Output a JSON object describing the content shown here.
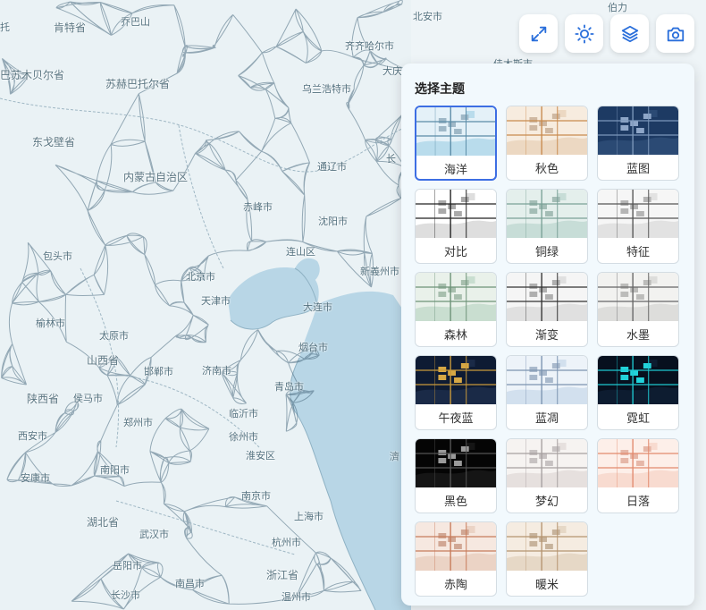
{
  "colors": {
    "map_bg": "#eef4f7",
    "road": "#4a6c80",
    "water": "#b8d6e6",
    "accent": "#3d6ee3"
  },
  "map": {
    "cities": [
      {
        "name": "托",
        "prov": false
      },
      {
        "name": "肯特省",
        "prov": true
      },
      {
        "name": "乔巴山",
        "prov": false
      },
      {
        "name": "北安市",
        "prov": false
      },
      {
        "name": "伯力",
        "prov": false
      },
      {
        "name": "齐齐哈尔市",
        "prov": false
      },
      {
        "name": "大庆",
        "prov": false
      },
      {
        "name": "佳木斯市",
        "prov": false
      },
      {
        "name": "巴苏木贝尔省",
        "prov": true
      },
      {
        "name": "苏赫巴托尔省",
        "prov": true
      },
      {
        "name": "乌兰浩特市",
        "prov": false
      },
      {
        "name": "东戈壁省",
        "prov": true
      },
      {
        "name": "通辽市",
        "prov": false
      },
      {
        "name": "长",
        "prov": false
      },
      {
        "name": "内蒙古自治区",
        "prov": true
      },
      {
        "name": "赤峰市",
        "prov": false
      },
      {
        "name": "沈阳市",
        "prov": false
      },
      {
        "name": "包头市",
        "prov": false
      },
      {
        "name": "连山区",
        "prov": false
      },
      {
        "name": "新義州市",
        "prov": false
      },
      {
        "name": "北京市",
        "prov": false
      },
      {
        "name": "天津市",
        "prov": false
      },
      {
        "name": "大连市",
        "prov": false
      },
      {
        "name": "榆林市",
        "prov": false
      },
      {
        "name": "太原市",
        "prov": false
      },
      {
        "name": "烟台市",
        "prov": false
      },
      {
        "name": "山西省",
        "prov": true
      },
      {
        "name": "邯郸市",
        "prov": false
      },
      {
        "name": "济南市",
        "prov": false
      },
      {
        "name": "青岛市",
        "prov": false
      },
      {
        "name": "陕西省",
        "prov": true
      },
      {
        "name": "侯马市",
        "prov": false
      },
      {
        "name": "郑州市",
        "prov": false
      },
      {
        "name": "临沂市",
        "prov": false
      },
      {
        "name": "西安市",
        "prov": false
      },
      {
        "name": "徐州市",
        "prov": false
      },
      {
        "name": "安康市",
        "prov": false
      },
      {
        "name": "南阳市",
        "prov": false
      },
      {
        "name": "淮安区",
        "prov": false
      },
      {
        "name": "南京市",
        "prov": false
      },
      {
        "name": "湖北省",
        "prov": true
      },
      {
        "name": "上海市",
        "prov": false
      },
      {
        "name": "武汉市",
        "prov": false
      },
      {
        "name": "杭州市",
        "prov": false
      },
      {
        "name": "岳阳市",
        "prov": false
      },
      {
        "name": "浙江省",
        "prov": true
      },
      {
        "name": "南昌市",
        "prov": false
      },
      {
        "name": "长沙市",
        "prov": false
      },
      {
        "name": "温州市",
        "prov": false
      },
      {
        "name": "濟",
        "prov": false
      }
    ]
  },
  "toolbar": {
    "buttons": [
      {
        "name": "fullscreen-button",
        "icon": "expand-icon"
      },
      {
        "name": "brightness-button",
        "icon": "sun-icon"
      },
      {
        "name": "layers-button",
        "icon": "layers-icon"
      },
      {
        "name": "screenshot-button",
        "icon": "camera-icon"
      }
    ]
  },
  "theme_panel": {
    "title": "选择主题",
    "selected": "海洋",
    "themes": [
      {
        "label": "海洋",
        "bg": "#e4f1f8",
        "line": "#5a8ba6",
        "water": "#b9dcec",
        "block": "#9fb8c7"
      },
      {
        "label": "秋色",
        "bg": "#f7ecdf",
        "line": "#c88a4e",
        "water": "#ecd8c2",
        "block": "#cfb8a2"
      },
      {
        "label": "蓝图",
        "bg": "#1d3a63",
        "line": "#7d98bb",
        "water": "#2b4a74",
        "block": "#8ea6c8"
      },
      {
        "label": "对比",
        "bg": "#ffffff",
        "line": "#222222",
        "water": "#dedede",
        "block": "#aaaaaa"
      },
      {
        "label": "铜绿",
        "bg": "#e4efec",
        "line": "#7aa197",
        "water": "#c7ddd7",
        "block": "#a4bdb6"
      },
      {
        "label": "特征",
        "bg": "#f6f6f6",
        "line": "#555555",
        "water": "#e2e2e2",
        "block": "#b5b5b5"
      },
      {
        "label": "森林",
        "bg": "#e9f1ea",
        "line": "#6d9278",
        "water": "#c9ded0",
        "block": "#a8bfae"
      },
      {
        "label": "渐变",
        "bg": "#f5f5f5",
        "line": "#333333",
        "water": "#e0e0e0",
        "block": "#b0b0b0"
      },
      {
        "label": "水墨",
        "bg": "#f2f2f0",
        "line": "#666666",
        "water": "#dddddb",
        "block": "#bcbcba"
      },
      {
        "label": "午夜蓝",
        "bg": "#0e1b33",
        "line": "#c99a3b",
        "water": "#1a2a47",
        "block": "#d6a845"
      },
      {
        "label": "蓝凋",
        "bg": "#edf3f9",
        "line": "#7b93b0",
        "water": "#d2e0ee",
        "block": "#a9b9cc"
      },
      {
        "label": "霓虹",
        "bg": "#07101e",
        "line": "#1ec8d0",
        "water": "#0d1c30",
        "block": "#22d3da"
      },
      {
        "label": "黑色",
        "bg": "#050505",
        "line": "#555555",
        "water": "#151515",
        "block": "#9a9a9a"
      },
      {
        "label": "梦幻",
        "bg": "#f6f3f1",
        "line": "#a6a0a0",
        "water": "#e6e0de",
        "block": "#c7c2c2"
      },
      {
        "label": "日落",
        "bg": "#fdefe9",
        "line": "#e28a6e",
        "water": "#f8dbd0",
        "block": "#e6b7a8"
      },
      {
        "label": "赤陶",
        "bg": "#f6e8e0",
        "line": "#c77b5b",
        "water": "#ebd3c5",
        "block": "#d1a794"
      },
      {
        "label": "暖米",
        "bg": "#f5ece1",
        "line": "#b59470",
        "water": "#e6d8c6",
        "block": "#c7b39c"
      }
    ]
  }
}
